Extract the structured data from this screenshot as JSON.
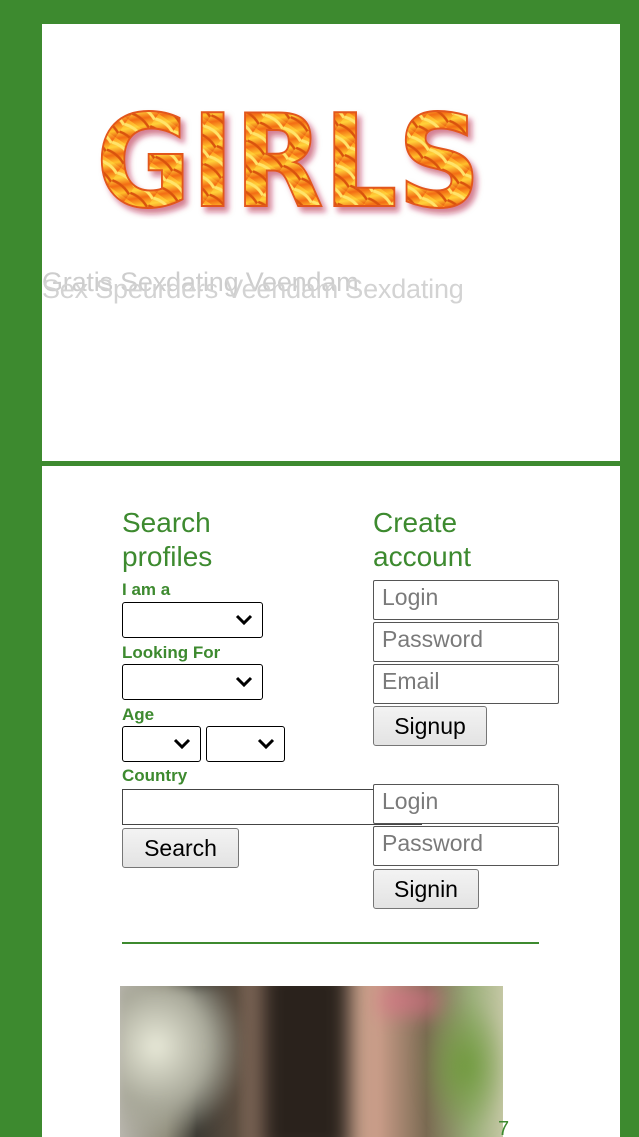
{
  "header": {
    "logo_text": "GIRLS",
    "tagline_overlap_a": "Gratis Sexdating Veendam",
    "tagline_overlap_b": "Sex Speurders Veendam Sexdating"
  },
  "search": {
    "title": "Search profiles",
    "iam_label": "I am a",
    "looking_label": "Looking For",
    "age_label": "Age",
    "country_label": "Country",
    "search_button": "Search"
  },
  "create": {
    "title": "Create account",
    "login_placeholder": "Login",
    "password_placeholder": "Password",
    "email_placeholder": "Email",
    "signup_button": "Signup"
  },
  "signin": {
    "login_placeholder": "Login",
    "password_placeholder": "Password",
    "signin_button": "Signin"
  },
  "footer": {
    "corner_number": "7"
  },
  "colors": {
    "brand_green": "#3d8a2f",
    "logo_orange": "#f57c1f",
    "logo_yellow": "#ffc62a"
  }
}
